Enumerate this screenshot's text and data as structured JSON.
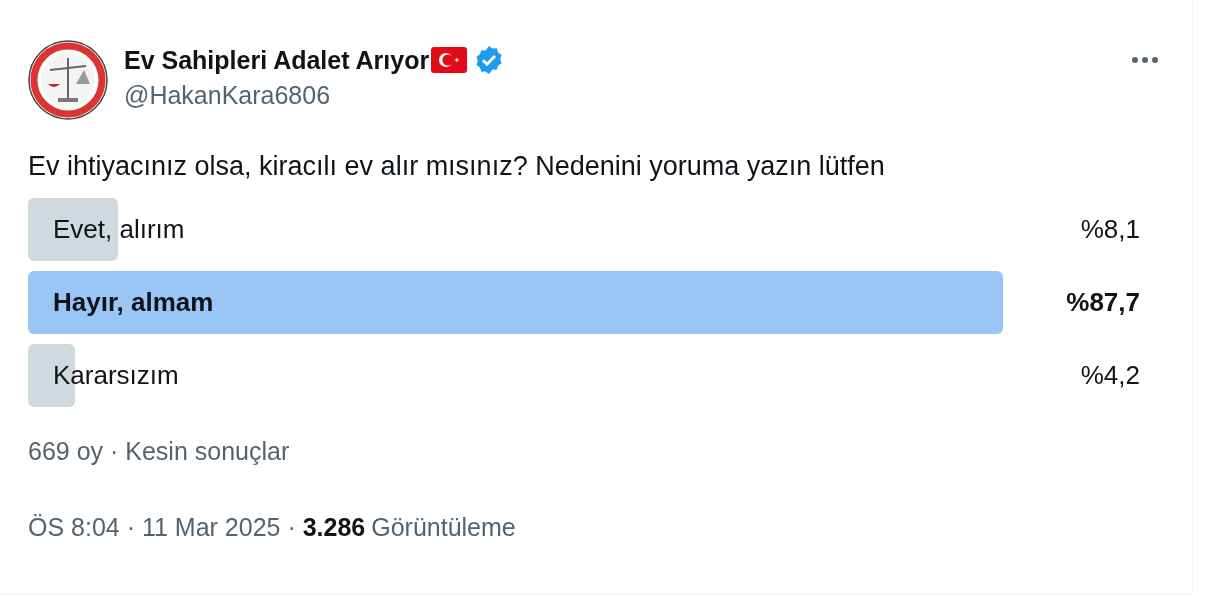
{
  "author": {
    "name": "Ev Sahipleri Adalet Arıyor",
    "handle": "@HakanKara6806",
    "verified": true
  },
  "text": "Ev ihtiyacınız olsa, kiracılı ev alır mısınız? Nedenini yoruma yazın lütfen",
  "poll": {
    "options": [
      {
        "label": "Evet, alırım",
        "percent": "%8,1",
        "leading": false
      },
      {
        "label": "Hayır, almam",
        "percent": "%87,7",
        "leading": true
      },
      {
        "label": "Kararsızım",
        "percent": "%4,2",
        "leading": false
      }
    ],
    "summary": "669 oy · Kesin sonuçlar"
  },
  "meta": {
    "time": "ÖS 8:04 · 11 Mar 2025 · ",
    "views_count": "3.286",
    "views_label": "Görüntüleme"
  }
}
